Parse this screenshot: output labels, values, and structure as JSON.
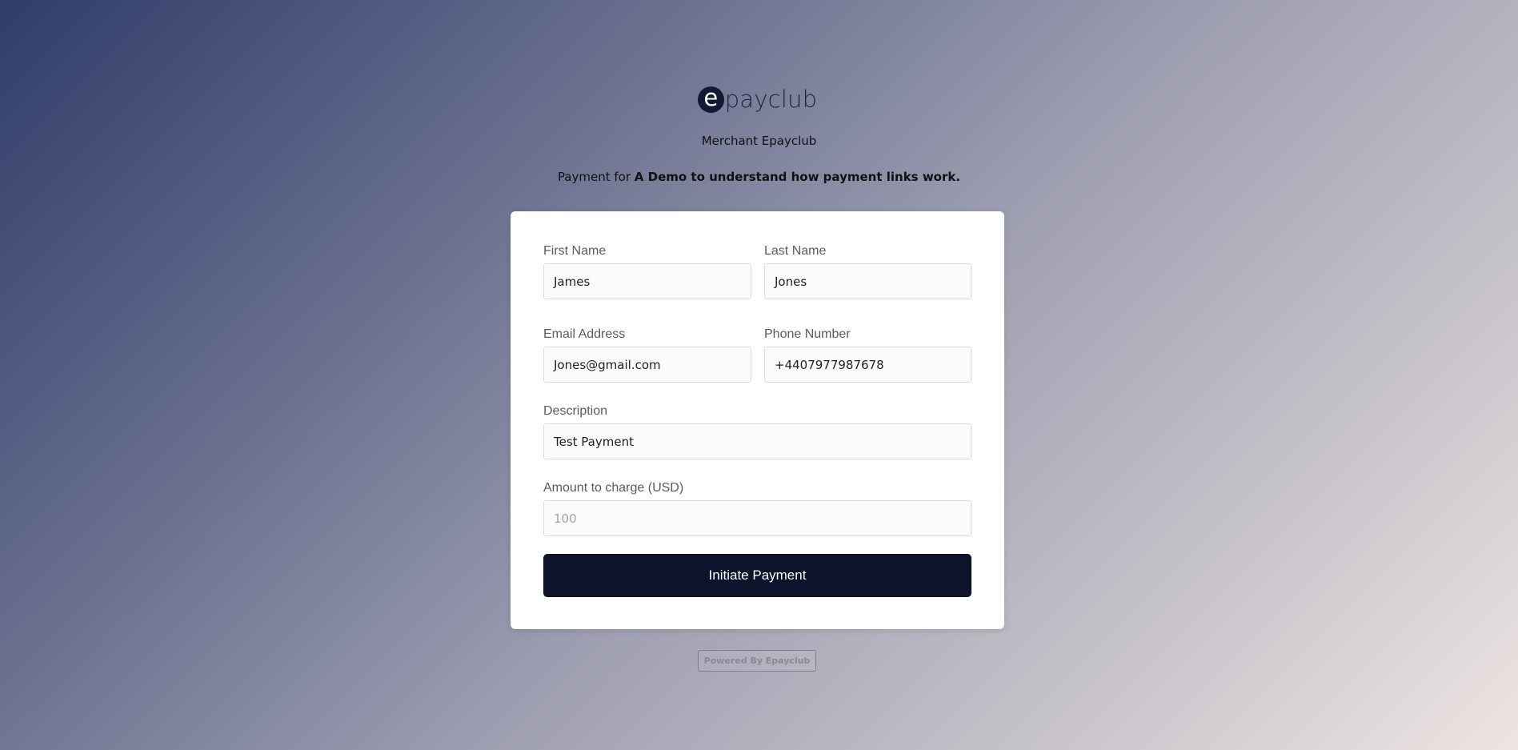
{
  "brand": {
    "logo_letter": "e",
    "logo_text": "payclub"
  },
  "merchant": "Merchant Epayclub",
  "payment_for": {
    "prefix": "Payment for",
    "title": "A Demo to understand how payment links work."
  },
  "form": {
    "first_name": {
      "label": "First Name",
      "value": "James"
    },
    "last_name": {
      "label": "Last Name",
      "value": "Jones"
    },
    "email": {
      "label": "Email Address",
      "value": "Jones@gmail.com"
    },
    "phone": {
      "label": "Phone Number",
      "value": "+4407977987678"
    },
    "description": {
      "label": "Description",
      "value": "Test Payment"
    },
    "amount": {
      "label": "Amount to charge (USD)",
      "placeholder": "100"
    },
    "submit_label": "Initiate Payment"
  },
  "footer": {
    "powered_by": "Powered By Epayclub"
  },
  "colors": {
    "button_bg": "#0c132b",
    "logo_circle": "#111a33"
  }
}
